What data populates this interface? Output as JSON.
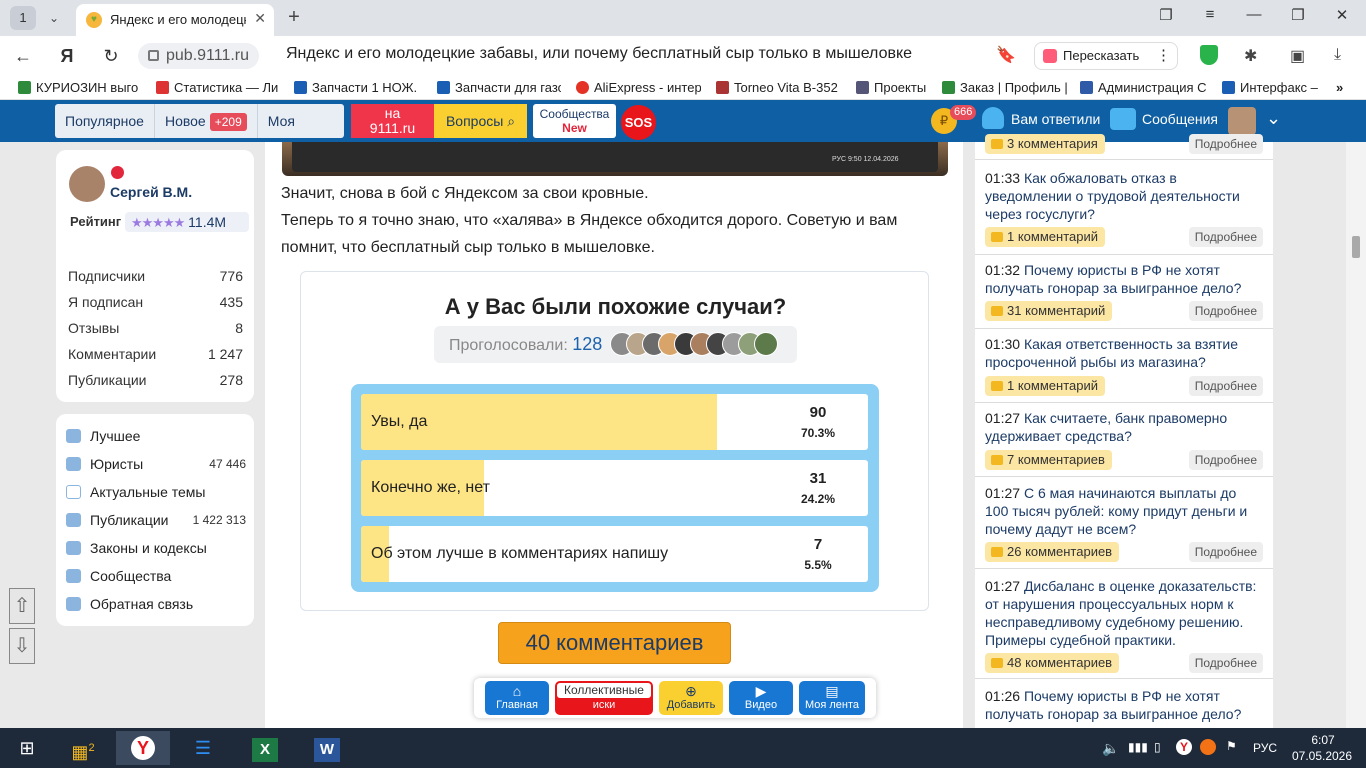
{
  "browser": {
    "tab_count": "1",
    "tab_title": "Яндекс и его молодецкие",
    "url_host": "pub.9111.ru",
    "page_title": "Яндекс и его молодецкие забавы, или почему бесплатный сыр только в мышеловке",
    "retell_label": "Пересказать",
    "bookmarks": [
      "КУРИОЗИН выго",
      "Статистика — Ли",
      "Запчасти 1 НОЖ.",
      "Запчасти для газо",
      "AliExpress - интер",
      "Torneo Vita B-352",
      "Проекты",
      "Заказ | Профиль |",
      "Администрация С",
      "Интерфакс –"
    ]
  },
  "site_nav": {
    "popular": "Популярное",
    "new": "Новое",
    "new_badge": "+209",
    "feed": "Моя лента",
    "on_9111_line1": "на",
    "on_9111_line2": "9111.ru",
    "questions": "Вопросы",
    "communities": "Сообщества",
    "communities_badge": "New",
    "sos": "SOS",
    "coins_badge": "666",
    "answered": "Вам ответили",
    "messages": "Сообщения"
  },
  "profile": {
    "name": "Сергей В.М.",
    "rating_label": "Рейтинг",
    "stars": "★★★★★",
    "rating_value": "11.4M",
    "stats": [
      {
        "label": "Подписчики",
        "value": "776"
      },
      {
        "label": "Я подписан",
        "value": "435"
      },
      {
        "label": "Отзывы",
        "value": "8"
      },
      {
        "label": "Комментарии",
        "value": "1 247"
      },
      {
        "label": "Публикации",
        "value": "278"
      }
    ]
  },
  "menu": [
    {
      "label": "Лучшее",
      "count": ""
    },
    {
      "label": "Юристы",
      "count": "47 446"
    },
    {
      "label": "Актуальные темы",
      "count": ""
    },
    {
      "label": "Публикации",
      "count": "1 422 313"
    },
    {
      "label": "Законы и кодексы",
      "count": ""
    },
    {
      "label": "Сообщества",
      "count": ""
    },
    {
      "label": "Обратная связь",
      "count": ""
    }
  ],
  "scroll_buttons": {
    "up": "⇧",
    "down": "⇩"
  },
  "article": {
    "screenshot_tray": "РУС 9:50 12.04.2026",
    "para1": "Значит, снова в бой с Яндексом за свои кровные.",
    "para2": "Теперь то я точно знаю, что «халява» в Яндексе обходится дорого. Советую и вам помнит, что бесплатный сыр только в мышеловке."
  },
  "poll": {
    "question": "А у Вас были похожие случаи?",
    "voted_label": "Проголосовали:",
    "voted_count": "128",
    "options": [
      {
        "label": "Увы, да",
        "count": "90",
        "percent": "70.3%",
        "share": 0.703
      },
      {
        "label": "Конечно же, нет",
        "count": "31",
        "percent": "24.2%",
        "share": 0.242
      },
      {
        "label": "Об этом лучше в комментариях напишу",
        "count": "7",
        "percent": "5.5%",
        "share": 0.055
      }
    ]
  },
  "comments_button": "40 комментариев",
  "bottom_bar": {
    "home": "Главная",
    "collective_1": "Коллективные",
    "collective_2": "иски",
    "add": "Добавить",
    "video": "Видео",
    "my_feed": "Моя лента"
  },
  "feed": {
    "more_label": "Подробнее",
    "items": [
      {
        "time": "",
        "title": "",
        "comments": "3 комментария"
      },
      {
        "time": "01:33",
        "title": "Как обжаловать отказ в уведомлении о трудовой деятельности через госуслуги?",
        "comments": "1 комментарий"
      },
      {
        "time": "01:32",
        "title": "Почему юристы в РФ не хотят получать гонорар за выигранное дело?",
        "comments": "31 комментарий"
      },
      {
        "time": "01:30",
        "title": "Какая ответственность за взятие просроченной рыбы из магазина?",
        "comments": "1 комментарий"
      },
      {
        "time": "01:27",
        "title": "Как считаете, банк правомерно удерживает средства?",
        "comments": "7 комментариев"
      },
      {
        "time": "01:27",
        "title": "С 6 мая начинаются выплаты до 100 тысяч рублей: кому придут деньги и почему дадут не всем?",
        "comments": "26 комментариев"
      },
      {
        "time": "01:27",
        "title": "Дисбаланс в оценке доказательств: от нарушения процессуальных норм к несправедливому судебному решению. Примеры судебной практики.",
        "comments": "48 комментариев"
      },
      {
        "time": "01:26",
        "title": "Почему юристы в РФ не хотят получать гонорар за выигранное дело?",
        "comments": ""
      }
    ]
  },
  "taskbar": {
    "lang": "РУС",
    "time": "6:07",
    "date": "07.05.2026",
    "weather_badge": "2"
  },
  "colors": {
    "site_blue": "#0e5fa3",
    "poll_fill": "#fde485",
    "poll_frame": "#8ccff5",
    "comments_orange": "#f7a21d"
  }
}
